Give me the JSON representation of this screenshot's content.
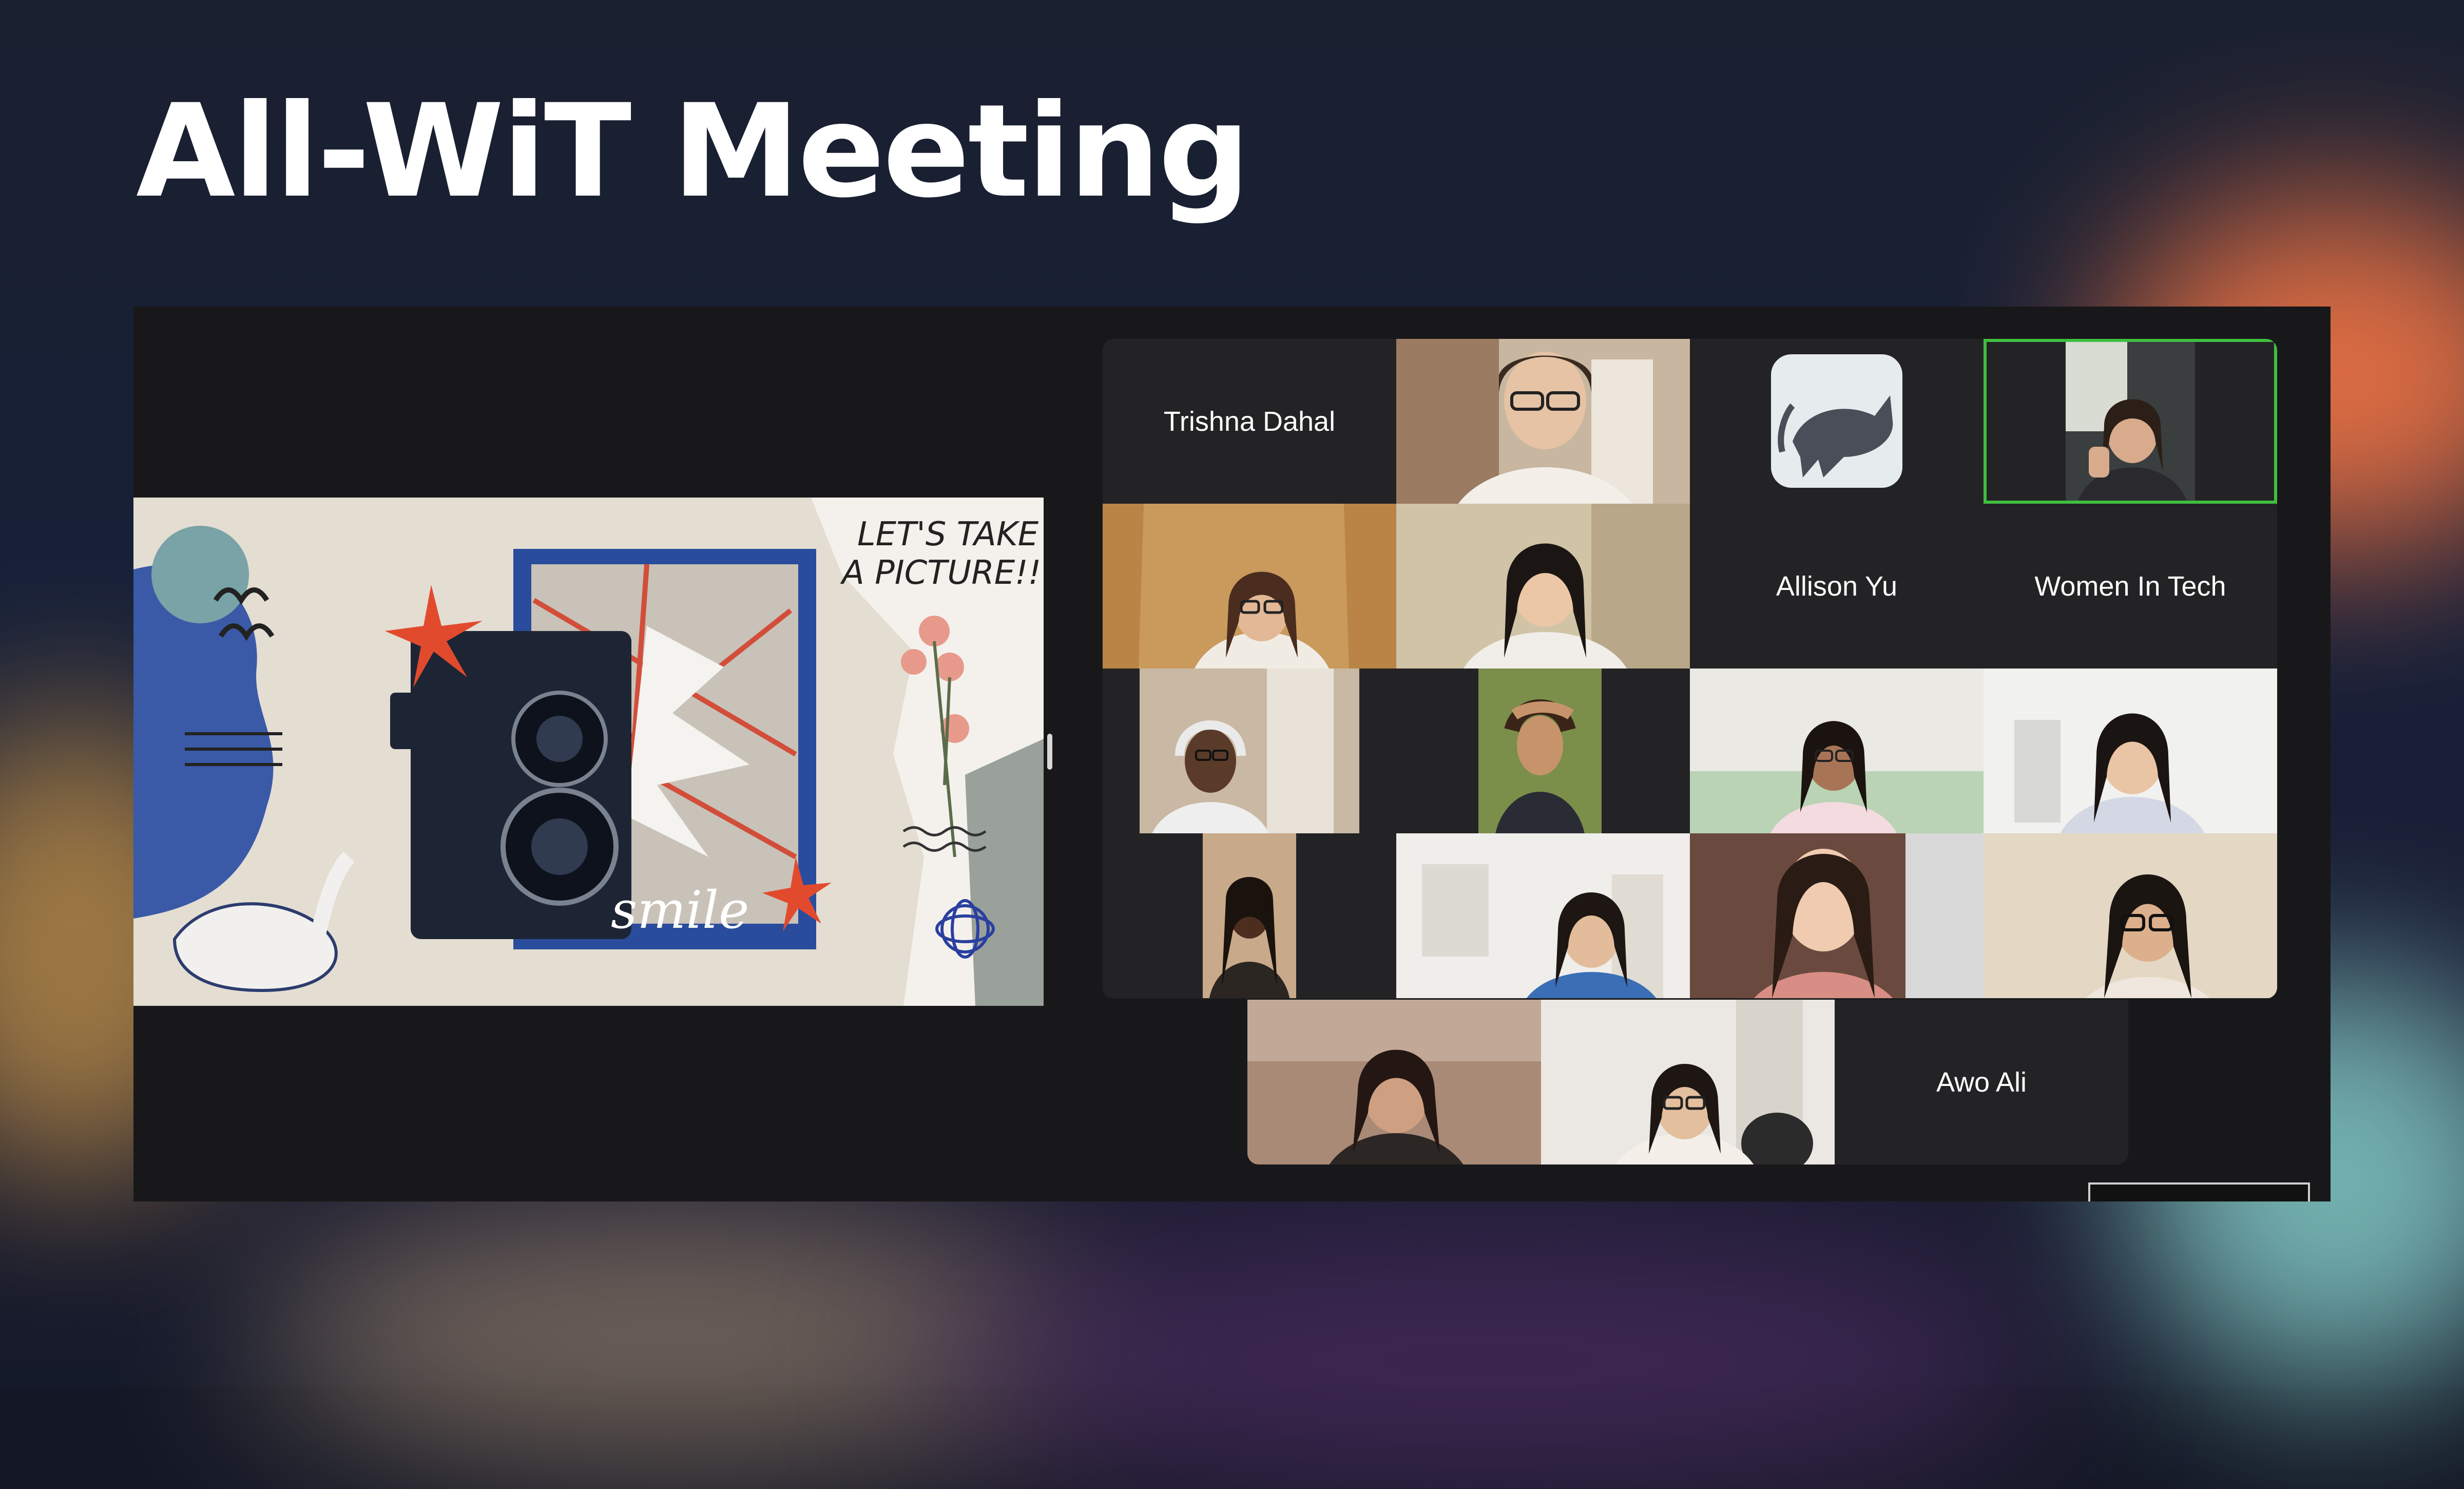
{
  "slide": {
    "title": "All-WiT Meeting"
  },
  "shared_screen": {
    "headline_line1": "LET'S TAKE",
    "headline_line2": "A PICTURE!!",
    "script_word": "smile"
  },
  "participants": [
    {
      "name": "Trishna Dahal",
      "video": false
    },
    {
      "name": "",
      "video": true
    },
    {
      "name": "",
      "video": false,
      "avatar": "cat-illustration"
    },
    {
      "name": "",
      "video": true,
      "active_speaker": true
    },
    {
      "name": "",
      "video": true
    },
    {
      "name": "",
      "video": true
    },
    {
      "name": "Allison Yu",
      "video": false
    },
    {
      "name": "Women In Tech",
      "video": false
    },
    {
      "name": "",
      "video": true
    },
    {
      "name": "",
      "video": true
    },
    {
      "name": "",
      "video": true
    },
    {
      "name": "",
      "video": true
    },
    {
      "name": "",
      "video": true
    },
    {
      "name": "",
      "video": true
    },
    {
      "name": "",
      "video": true
    },
    {
      "name": "",
      "video": true
    },
    {
      "name": "",
      "video": true
    },
    {
      "name": "",
      "video": true
    },
    {
      "name": "Awo Ali",
      "video": false
    }
  ],
  "colors": {
    "active_speaker_border": "#3fbf3f",
    "tile_background": "#232325",
    "screen_background": "#18181a"
  }
}
